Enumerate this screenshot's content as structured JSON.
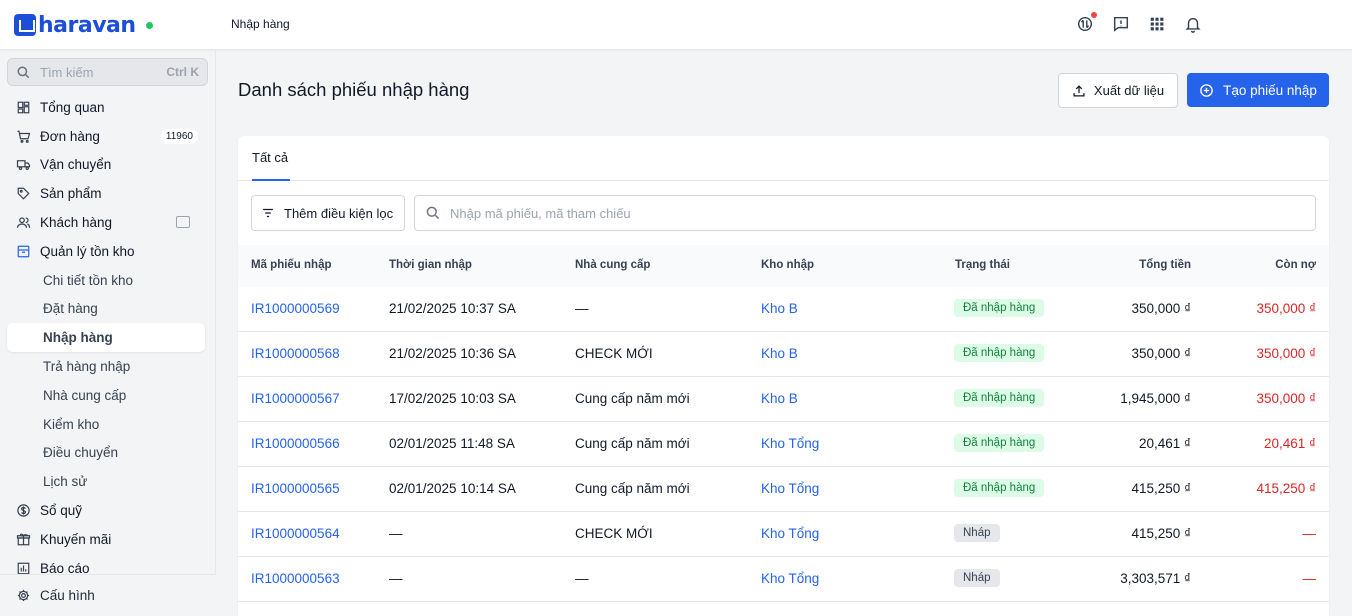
{
  "app": {
    "logo_text": "haravan",
    "breadcrumb": "Nhập hàng"
  },
  "sidebar": {
    "search_placeholder": "Tìm kiếm",
    "search_shortcut": "Ctrl K",
    "items": [
      {
        "label": "Tổng quan",
        "icon": "dashboard-icon"
      },
      {
        "label": "Đơn hàng",
        "icon": "cart-icon",
        "badge": "11960"
      },
      {
        "label": "Vận chuyển",
        "icon": "truck-icon"
      },
      {
        "label": "Sản phẩm",
        "icon": "tag-icon"
      },
      {
        "label": "Khách hàng",
        "icon": "users-icon"
      },
      {
        "label": "Quản lý tồn kho",
        "icon": "inventory-icon"
      }
    ],
    "sub_items": [
      {
        "label": "Chi tiết tồn kho"
      },
      {
        "label": "Đặt hàng"
      },
      {
        "label": "Nhập hàng",
        "active": true
      },
      {
        "label": "Trả hàng nhập"
      },
      {
        "label": "Nhà cung cấp"
      },
      {
        "label": "Kiểm kho"
      },
      {
        "label": "Điều chuyển"
      },
      {
        "label": "Lịch sử"
      }
    ],
    "bottom_items": [
      {
        "label": "Sổ quỹ",
        "icon": "dollar-icon"
      },
      {
        "label": "Khuyến mãi",
        "icon": "gift-icon"
      },
      {
        "label": "Báo cáo",
        "icon": "report-icon"
      }
    ],
    "footer": "Cấu hình"
  },
  "main": {
    "title": "Danh sách phiếu nhập hàng",
    "export_label": "Xuất dữ liệu",
    "create_label": "Tạo phiếu nhập",
    "tab_all": "Tất cả",
    "filter_label": "Thêm điều kiện lọc",
    "search_placeholder": "Nhập mã phiếu, mã tham chiếu"
  },
  "table": {
    "headers": [
      "Mã phiếu nhập",
      "Thời gian nhập",
      "Nhà cung cấp",
      "Kho nhập",
      "Trạng thái",
      "Tổng tiền",
      "Còn nợ"
    ],
    "rows": [
      {
        "code": "IR1000000569",
        "time": "21/02/2025 10:37 SA",
        "supplier": "—",
        "warehouse": "Kho B",
        "status": "Đã nhập hàng",
        "status_type": "done",
        "total": "350,000 ₫",
        "debt": "350,000 ₫"
      },
      {
        "code": "IR1000000568",
        "time": "21/02/2025 10:36 SA",
        "supplier": "CHECK MỚI",
        "warehouse": "Kho B",
        "status": "Đã nhập hàng",
        "status_type": "done",
        "total": "350,000 ₫",
        "debt": "350,000 ₫"
      },
      {
        "code": "IR1000000567",
        "time": "17/02/2025 10:03 SA",
        "supplier": "Cung cấp năm mới",
        "warehouse": "Kho B",
        "status": "Đã nhập hàng",
        "status_type": "done",
        "total": "1,945,000 ₫",
        "debt": "350,000 ₫"
      },
      {
        "code": "IR1000000566",
        "time": "02/01/2025 11:48 SA",
        "supplier": "Cung cấp năm mới",
        "warehouse": "Kho Tổng",
        "status": "Đã nhập hàng",
        "status_type": "done",
        "total": "20,461 ₫",
        "debt": "20,461 ₫"
      },
      {
        "code": "IR1000000565",
        "time": "02/01/2025 10:14 SA",
        "supplier": "Cung cấp năm mới",
        "warehouse": "Kho Tổng",
        "status": "Đã nhập hàng",
        "status_type": "done",
        "total": "415,250 ₫",
        "debt": "415,250 ₫"
      },
      {
        "code": "IR1000000564",
        "time": "—",
        "supplier": "CHECK MỚI",
        "warehouse": "Kho Tổng",
        "status": "Nháp",
        "status_type": "draft",
        "total": "415,250 ₫",
        "debt": "—"
      },
      {
        "code": "IR1000000563",
        "time": "—",
        "supplier": "—",
        "warehouse": "Kho Tổng",
        "status": "Nháp",
        "status_type": "draft",
        "total": "3,303,571 ₫",
        "debt": "—"
      }
    ]
  }
}
